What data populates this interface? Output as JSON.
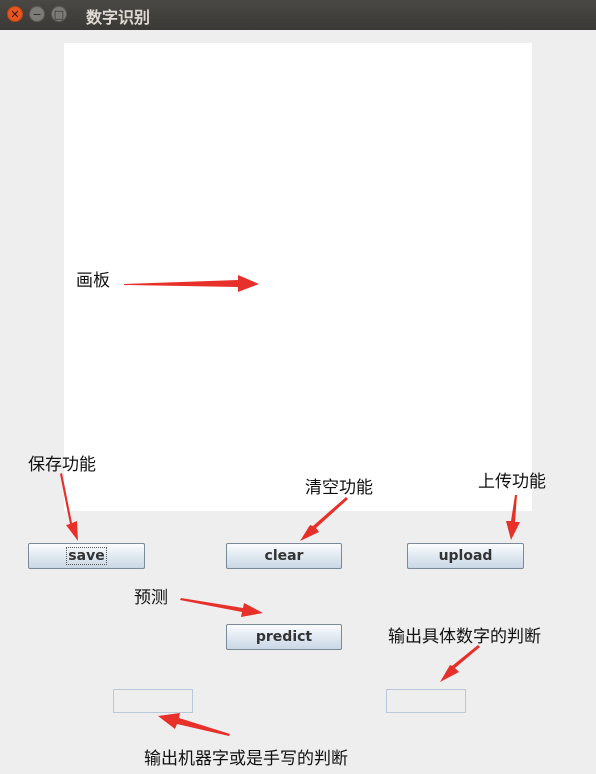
{
  "window": {
    "title": "数字识别"
  },
  "buttons": {
    "save": "save",
    "clear": "clear",
    "upload": "upload",
    "predict": "predict"
  },
  "annotations": {
    "canvas": "画板",
    "save": "保存功能",
    "clear": "清空功能",
    "upload": "上传功能",
    "predict": "预测",
    "digit_output": "输出具体数字的判断",
    "type_output": "输出机器字或是手写的判断"
  },
  "colors": {
    "arrow": "#e8302a",
    "canvas": "#ffffff",
    "background": "#eeeeee"
  },
  "icons": {
    "close": "close-icon",
    "minimize": "minimize-icon",
    "maximize": "maximize-icon"
  }
}
